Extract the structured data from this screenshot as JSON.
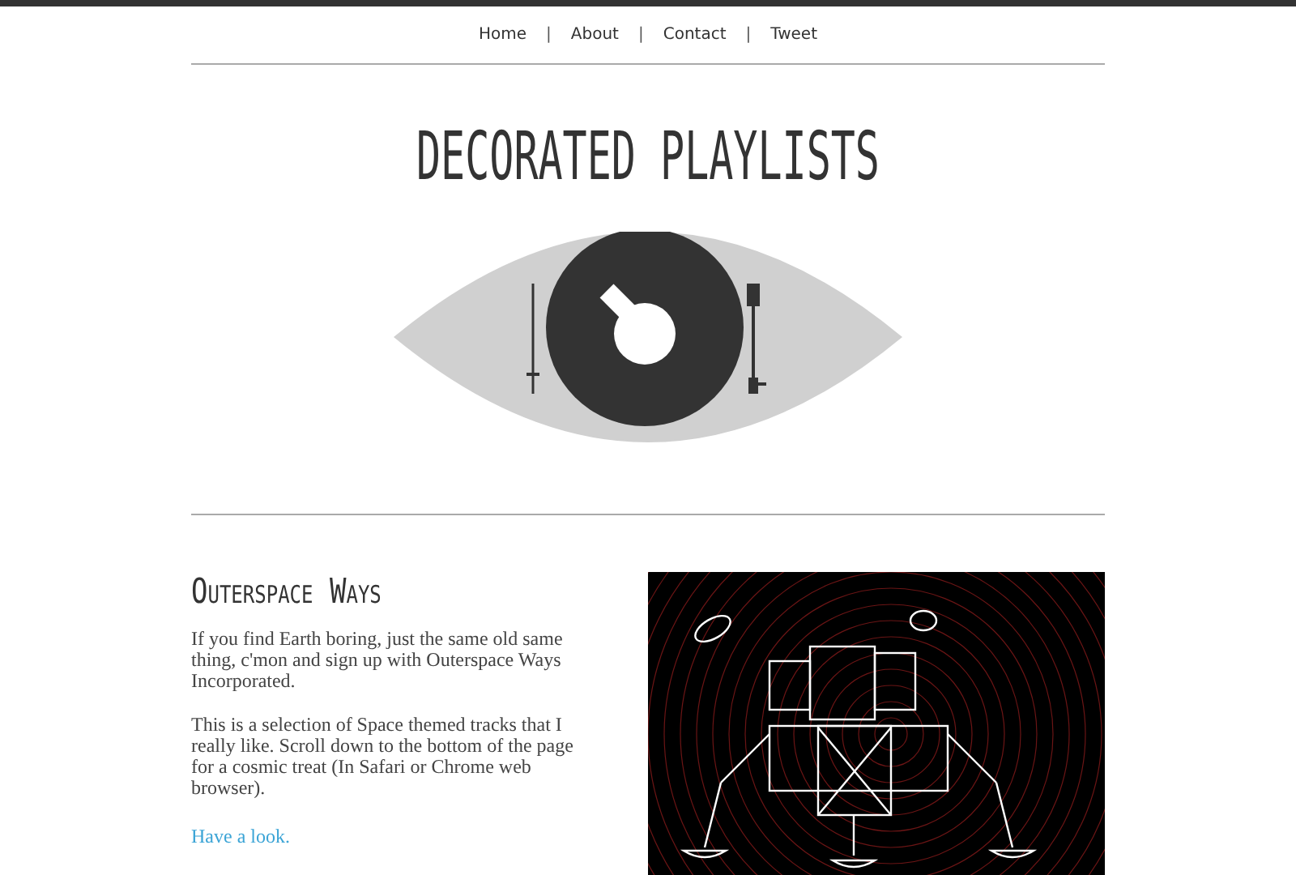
{
  "nav": {
    "links": [
      {
        "label": "Home"
      },
      {
        "label": "About"
      },
      {
        "label": "Contact"
      },
      {
        "label": "Tweet"
      }
    ],
    "separator": "|"
  },
  "site_title": "DECORATED PLAYLISTS",
  "section": {
    "heading": "Outerspace Ways",
    "paragraphs": [
      "If you find Earth boring, just the same old same thing, c'mon and sign up with Outerspace Ways Incorporated.",
      "This is a selection of Space themed tracks that I really like. Scroll down to the bottom of the page for a cosmic treat (In Safari or Chrome web browser)."
    ],
    "link": "Have a look."
  }
}
